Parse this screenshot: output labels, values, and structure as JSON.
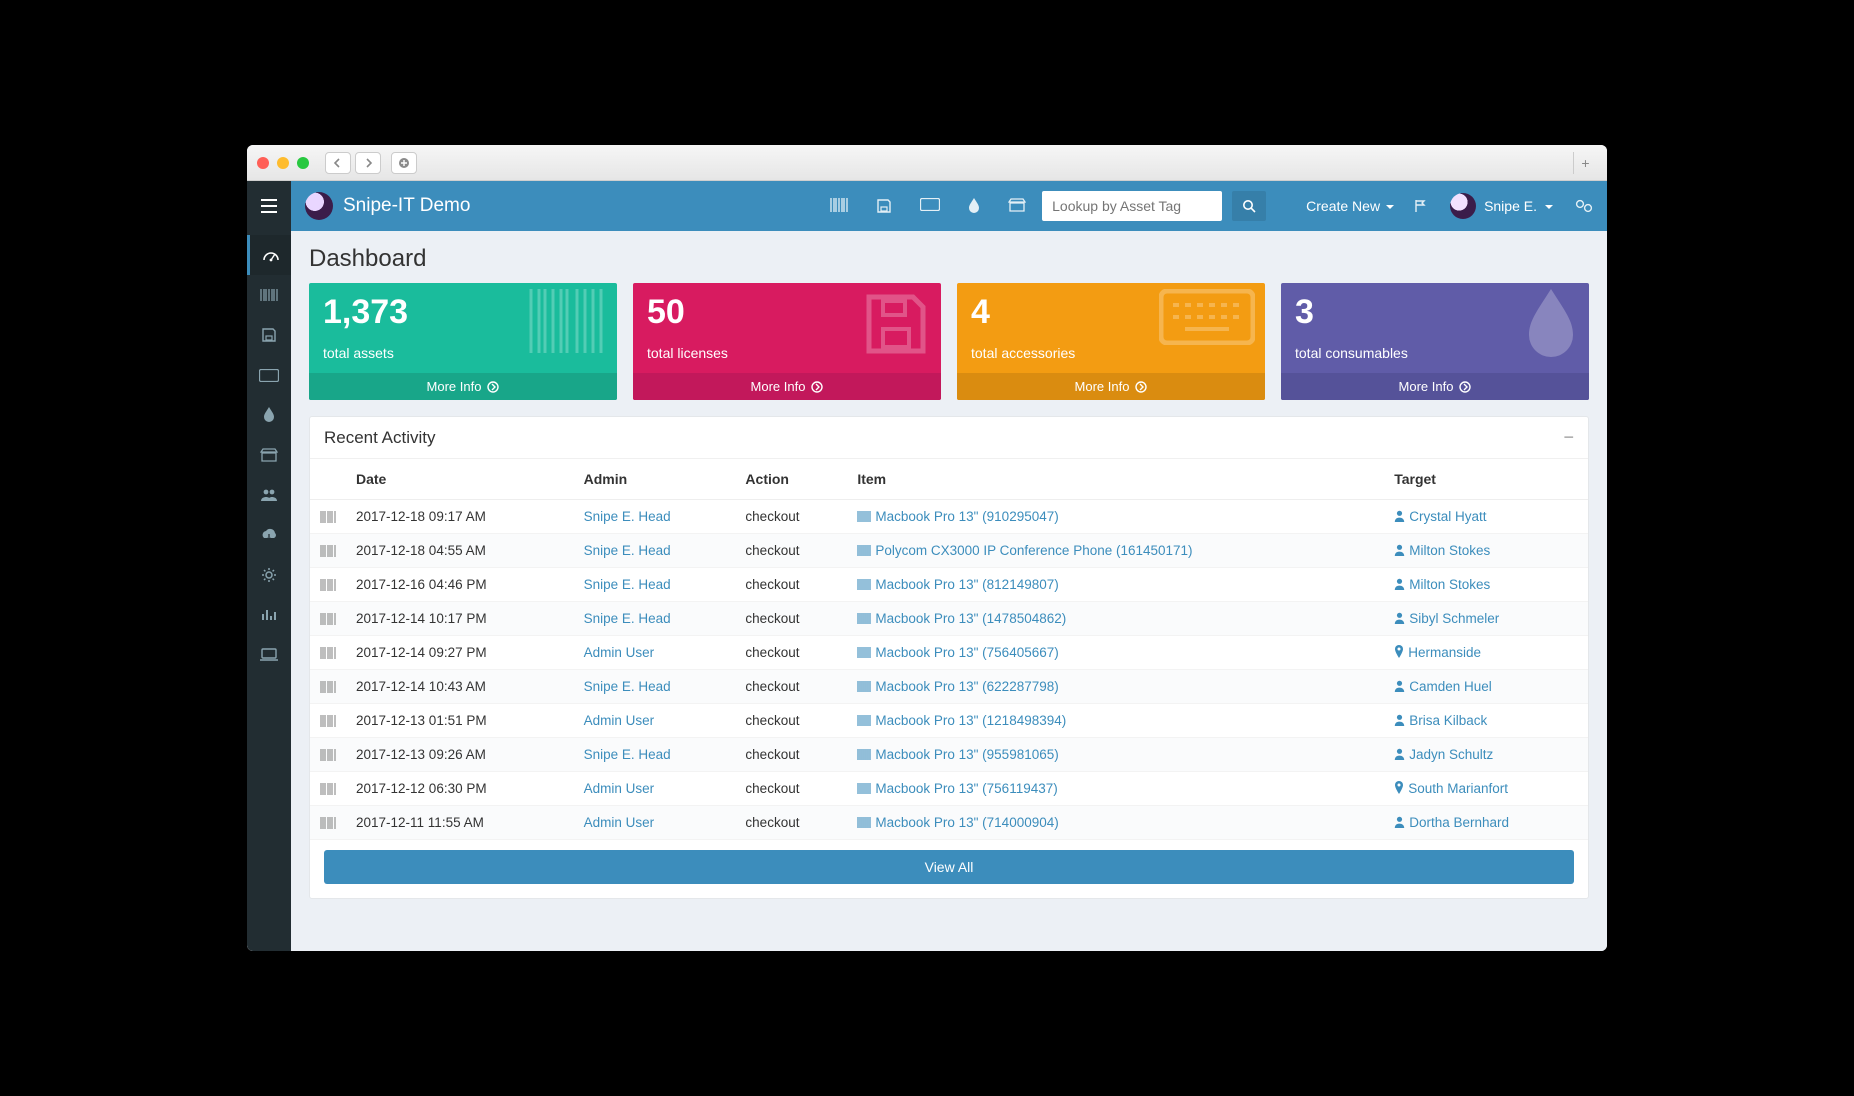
{
  "app_title": "Snipe-IT Demo",
  "search_placeholder": "Lookup by Asset Tag",
  "create_new_label": "Create New",
  "user_name": "Snipe E.",
  "page_title": "Dashboard",
  "cards": [
    {
      "value": "1,373",
      "label": "total assets",
      "more": "More Info"
    },
    {
      "value": "50",
      "label": "total licenses",
      "more": "More Info"
    },
    {
      "value": "4",
      "label": "total accessories",
      "more": "More Info"
    },
    {
      "value": "3",
      "label": "total consumables",
      "more": "More Info"
    }
  ],
  "activity": {
    "title": "Recent Activity",
    "view_all": "View All",
    "columns": {
      "date": "Date",
      "admin": "Admin",
      "action": "Action",
      "item": "Item",
      "target": "Target"
    },
    "rows": [
      {
        "date": "2017-12-18 09:17 AM",
        "admin": "Snipe E. Head",
        "action": "checkout",
        "item": "Macbook Pro 13\" (910295047)",
        "target": "Crystal Hyatt",
        "target_type": "user"
      },
      {
        "date": "2017-12-18 04:55 AM",
        "admin": "Snipe E. Head",
        "action": "checkout",
        "item": "Polycom CX3000 IP Conference Phone (161450171)",
        "target": "Milton Stokes",
        "target_type": "user"
      },
      {
        "date": "2017-12-16 04:46 PM",
        "admin": "Snipe E. Head",
        "action": "checkout",
        "item": "Macbook Pro 13\" (812149807)",
        "target": "Milton Stokes",
        "target_type": "user"
      },
      {
        "date": "2017-12-14 10:17 PM",
        "admin": "Snipe E. Head",
        "action": "checkout",
        "item": "Macbook Pro 13\" (1478504862)",
        "target": "Sibyl Schmeler",
        "target_type": "user"
      },
      {
        "date": "2017-12-14 09:27 PM",
        "admin": "Admin User",
        "action": "checkout",
        "item": "Macbook Pro 13\" (756405667)",
        "target": "Hermanside",
        "target_type": "location"
      },
      {
        "date": "2017-12-14 10:43 AM",
        "admin": "Snipe E. Head",
        "action": "checkout",
        "item": "Macbook Pro 13\" (622287798)",
        "target": "Camden Huel",
        "target_type": "user"
      },
      {
        "date": "2017-12-13 01:51 PM",
        "admin": "Admin User",
        "action": "checkout",
        "item": "Macbook Pro 13\" (1218498394)",
        "target": "Brisa Kilback",
        "target_type": "user"
      },
      {
        "date": "2017-12-13 09:26 AM",
        "admin": "Snipe E. Head",
        "action": "checkout",
        "item": "Macbook Pro 13\" (955981065)",
        "target": "Jadyn Schultz",
        "target_type": "user"
      },
      {
        "date": "2017-12-12 06:30 PM",
        "admin": "Admin User",
        "action": "checkout",
        "item": "Macbook Pro 13\" (756119437)",
        "target": "South Marianfort",
        "target_type": "location"
      },
      {
        "date": "2017-12-11 11:55 AM",
        "admin": "Admin User",
        "action": "checkout",
        "item": "Macbook Pro 13\" (714000904)",
        "target": "Dortha Bernhard",
        "target_type": "user"
      }
    ]
  }
}
